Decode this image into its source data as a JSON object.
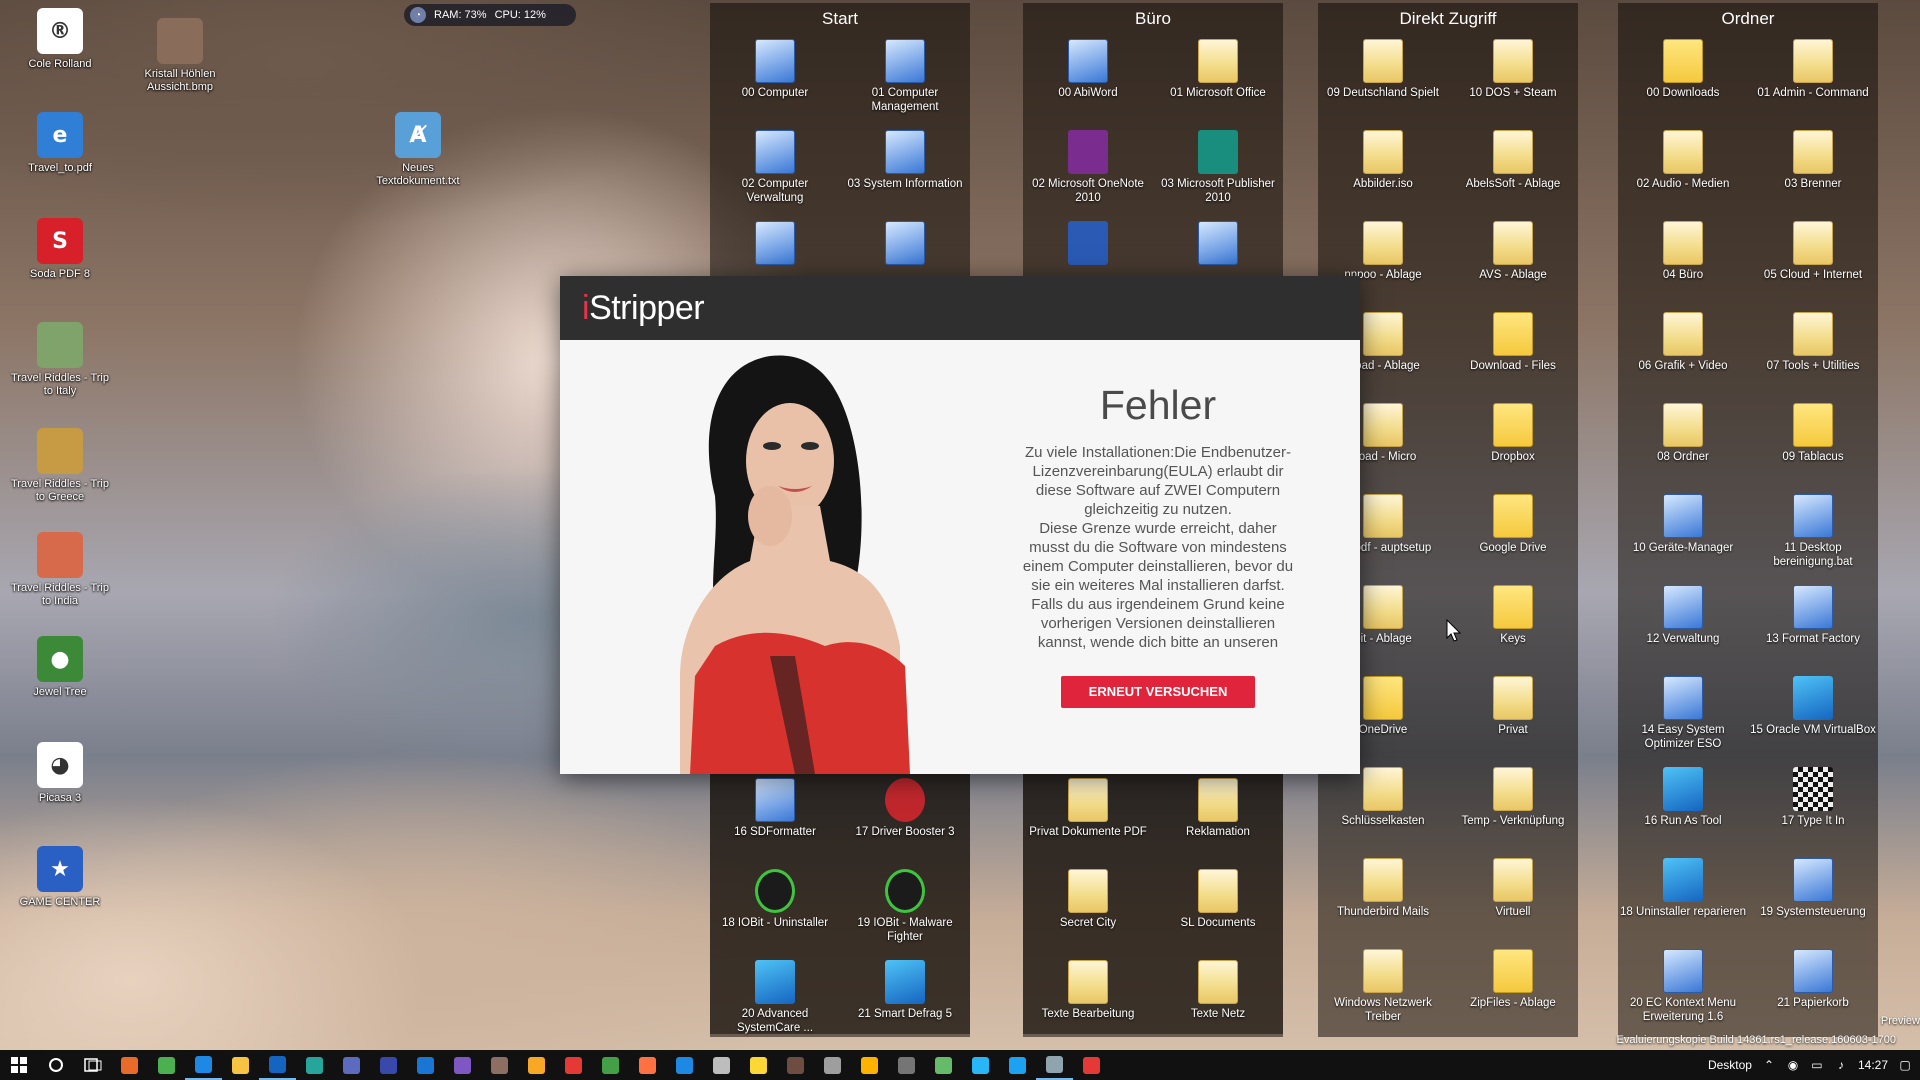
{
  "system_monitor": {
    "ram": "RAM: 73%",
    "cpu": "CPU: 12%"
  },
  "desktop_icons": [
    {
      "label": "Cole Rolland",
      "color": "#ffffff",
      "glyph": "®"
    },
    {
      "label": "Kristall Höhlen Aussicht.bmp",
      "color": "#8a6c5a",
      "glyph": ""
    },
    {
      "label": "Travel_to.pdf",
      "color": "#2f7fd6",
      "glyph": "e"
    },
    {
      "label": "Neues Textdokument.txt",
      "color": "#5aa0d8",
      "glyph": "Ⱥ"
    },
    {
      "label": "Soda PDF 8",
      "color": "#d8202a",
      "glyph": "S"
    },
    {
      "label": "Travel Riddles - Trip to Italy",
      "color": "#7fa36a",
      "glyph": ""
    },
    {
      "label": "Travel Riddles - Trip to Greece",
      "color": "#c79a44",
      "glyph": ""
    },
    {
      "label": "Travel Riddles - Trip to India",
      "color": "#d66a4a",
      "glyph": ""
    },
    {
      "label": "Jewel Tree",
      "color": "#3c8a38",
      "glyph": "●"
    },
    {
      "label": "Picasa 3",
      "color": "#ffffff",
      "glyph": "◕"
    },
    {
      "label": "GAME CENTER",
      "color": "#2a5fc4",
      "glyph": "★"
    }
  ],
  "fences": [
    {
      "title": "Start",
      "items": [
        {
          "label": "00 Computer",
          "kind": "sys"
        },
        {
          "label": "01 Computer Management",
          "kind": "sys"
        },
        {
          "label": "02 Computer Verwaltung",
          "kind": "sys"
        },
        {
          "label": "03 System Information",
          "kind": "sys"
        },
        {
          "label": "",
          "kind": "sys"
        },
        {
          "label": "",
          "kind": "sys"
        }
      ],
      "bottom": [
        {
          "label": "16 SDFormatter",
          "kind": "sys"
        },
        {
          "label": "17 Driver Booster 3",
          "kind": "red"
        },
        {
          "label": "18 IOBit - Uninstaller",
          "kind": "green"
        },
        {
          "label": "19 IOBit - Malware Fighter",
          "kind": "green"
        },
        {
          "label": "20 Advanced SystemCare ...",
          "kind": "blue"
        },
        {
          "label": "21 Smart Defrag 5",
          "kind": "blue"
        }
      ]
    },
    {
      "title": "Büro",
      "items": [
        {
          "label": "00 AbiWord",
          "kind": "sys"
        },
        {
          "label": "01 Microsoft Office",
          "kind": "folder"
        },
        {
          "label": "02 Microsoft OneNote 2010",
          "kind": "purple"
        },
        {
          "label": "03 Microsoft Publisher 2010",
          "kind": "teal"
        },
        {
          "label": "",
          "kind": "word"
        },
        {
          "label": "",
          "kind": "sys"
        }
      ],
      "bottom": [
        {
          "label": "Privat Dokumente PDF",
          "kind": "folder"
        },
        {
          "label": "Reklamation",
          "kind": "folder"
        },
        {
          "label": "Secret City",
          "kind": "folder"
        },
        {
          "label": "SL Documents",
          "kind": "folder"
        },
        {
          "label": "Texte Bearbeitung",
          "kind": "folder"
        },
        {
          "label": "Texte Netz",
          "kind": "folder"
        }
      ]
    },
    {
      "title": "Direkt Zugriff",
      "items": [
        {
          "label": "09 Deutschland Spielt",
          "kind": "folder"
        },
        {
          "label": "10 DOS + Steam",
          "kind": "folder"
        },
        {
          "label": "Abbilder.iso",
          "kind": "folder"
        },
        {
          "label": "AbelsSoft - Ablage",
          "kind": "folder"
        },
        {
          "label": "nnpoo - Ablage",
          "kind": "folder"
        },
        {
          "label": "AVS - Ablage",
          "kind": "folder"
        },
        {
          "label": "nload - Ablage",
          "kind": "folder"
        },
        {
          "label": "Download - Files",
          "kind": "folder-y"
        },
        {
          "label": "nload - Micro",
          "kind": "folder"
        },
        {
          "label": "Dropbox",
          "kind": "folder-y"
        },
        {
          "label": "freepdf - auptsetup",
          "kind": "folder"
        },
        {
          "label": "Google Drive",
          "kind": "folder-y"
        },
        {
          "label": "bit - Ablage",
          "kind": "folder"
        },
        {
          "label": "Keys",
          "kind": "folder-y"
        },
        {
          "label": "OneDrive",
          "kind": "folder-y"
        },
        {
          "label": "Privat",
          "kind": "folder"
        },
        {
          "label": "Schlüsselkasten",
          "kind": "folder"
        },
        {
          "label": "Temp - Verknüpfung",
          "kind": "folder"
        },
        {
          "label": "Thunderbird Mails",
          "kind": "folder"
        },
        {
          "label": "Virtuell",
          "kind": "folder"
        },
        {
          "label": "Windows Netzwerk Treiber",
          "kind": "folder"
        },
        {
          "label": "ZipFiles - Ablage",
          "kind": "folder-y"
        }
      ]
    },
    {
      "title": "Ordner",
      "items": [
        {
          "label": "00 Downloads",
          "kind": "folder-y"
        },
        {
          "label": "01 Admin - Command",
          "kind": "folder"
        },
        {
          "label": "02 Audio - Medien",
          "kind": "folder"
        },
        {
          "label": "03 Brenner",
          "kind": "folder"
        },
        {
          "label": "04 Büro",
          "kind": "folder"
        },
        {
          "label": "05 Cloud + Internet",
          "kind": "folder"
        },
        {
          "label": "06 Grafik + Video",
          "kind": "folder"
        },
        {
          "label": "07 Tools + Utilities",
          "kind": "folder"
        },
        {
          "label": "08 Ordner",
          "kind": "folder"
        },
        {
          "label": "09 Tablacus",
          "kind": "folder-y"
        },
        {
          "label": "10 Geräte-Manager",
          "kind": "sys"
        },
        {
          "label": "11 Desktop bereinigung.bat",
          "kind": "sys"
        },
        {
          "label": "12 Verwaltung",
          "kind": "sys"
        },
        {
          "label": "13 Format Factory",
          "kind": "sys"
        },
        {
          "label": "14 Easy System Optimizer ESO",
          "kind": "sys"
        },
        {
          "label": "15 Oracle VM VirtualBox",
          "kind": "blue"
        },
        {
          "label": "16 Run As Tool",
          "kind": "blue"
        },
        {
          "label": "17 Type It In",
          "kind": "checker"
        },
        {
          "label": "18 Uninstaller reparieren",
          "kind": "blue"
        },
        {
          "label": "19 Systemsteuerung",
          "kind": "sys"
        },
        {
          "label": "20 EC Kontext Menu Erweiterung 1.6",
          "kind": "sys"
        },
        {
          "label": "21 Papierkorb",
          "kind": "sys"
        }
      ]
    }
  ],
  "dialog": {
    "logo": "iStripper",
    "title": "Fehler",
    "message": "Zu viele Installationen:Die Endbenutzer-\nLizenzvereinbarung(EULA) erlaubt dir\ndiese Software auf ZWEI Computern\ngleichzeitig zu nutzen.\nDiese Grenze wurde erreicht, daher\nmusst du die Software von mindestens\neinem Computer deinstallieren, bevor du\nsie ein weiteres Mal installieren darfst.\nFalls du aus irgendeinem Grund keine\nvorherigen Versionen deinstallieren\nkannst, wende dich bitte an unseren",
    "retry_label": "ERNEUT VERSUCHEN",
    "accent": "#e0243c"
  },
  "watermark": "Evaluierungskopie Build 14361.rs1_release.160603-1700",
  "preview_text": "Preview",
  "taskbar": {
    "desktop_label": "Desktop",
    "clock": "14:27",
    "apps": [
      "#e86b2a",
      "#4caf50",
      "#1e88e5",
      "#f6c343",
      "#1565c0",
      "#26a69a",
      "#5c6bc0",
      "#3949ab",
      "#1976d2",
      "#7e57c2",
      "#8d6e63",
      "#f9a825",
      "#e53935",
      "#43a047",
      "#ff7043",
      "#1e88e5",
      "#bdbdbd",
      "#fdd835",
      "#6d4c41",
      "#9e9e9e",
      "#ffb300",
      "#757575",
      "#66bb6a",
      "#29b6f6",
      "#1da1f2",
      "#90a4ae",
      "#e53935"
    ]
  }
}
